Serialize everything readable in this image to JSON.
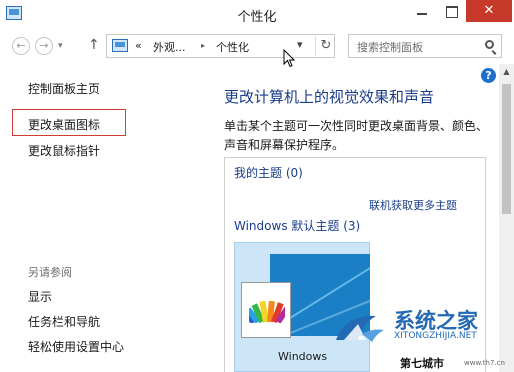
{
  "window": {
    "title": "个性化",
    "close_label": "✕",
    "minimize_icon": "minimize-icon",
    "maximize_icon": "maximize-icon"
  },
  "nav": {
    "back_label": "←",
    "forward_label": "→",
    "recent_label": "▾",
    "up_label": "↑",
    "address_prefix": "«",
    "breadcrumb": [
      "外观...",
      "个性化"
    ],
    "breadcrumb_sep": "▸",
    "dropdown_label": "▾",
    "refresh_label": "↻",
    "search_placeholder": "搜索控制面板"
  },
  "sidebar": {
    "home": "控制面板主页",
    "links": [
      "更改桌面图标",
      "更改鼠标指针"
    ],
    "see_also_title": "另请参阅",
    "see_also_links": [
      "显示",
      "任务栏和导航",
      "轻松使用设置中心"
    ]
  },
  "main": {
    "help_label": "?",
    "heading": "更改计算机上的视觉效果和声音",
    "description": "单击某个主题可一次性同时更改桌面背景、颜色、声音和屏幕保护程序。",
    "my_themes": "我的主题 (0)",
    "online_link": "联机获取更多主题",
    "default_themes": "Windows 默认主题 (3)",
    "theme_name": "Windows"
  },
  "watermark": {
    "name": "系统之家",
    "url": "XITONGZHIJIA.NET",
    "badge": "第七城市",
    "badge_url": "www.th7.cn"
  },
  "colors": {
    "accent": "#1a3c8a",
    "close": "#c7392b",
    "highlight": "#d23a33",
    "theme_blue": "#1a7fc4"
  }
}
